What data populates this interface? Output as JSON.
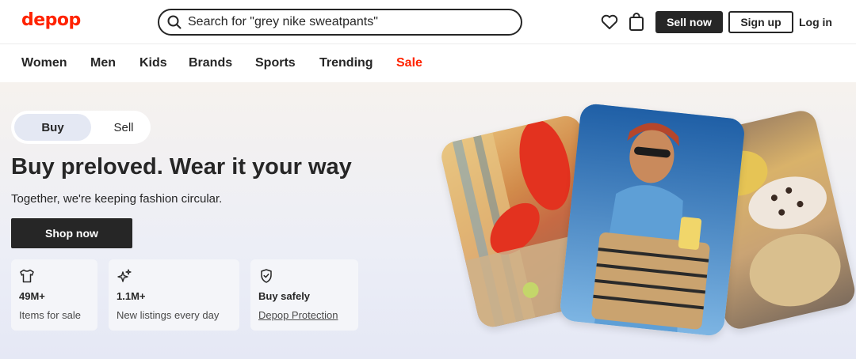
{
  "header": {
    "logo": "depop",
    "search_placeholder": "Search for \"grey nike sweatpants\"",
    "sell_now": "Sell now",
    "sign_up": "Sign up",
    "log_in": "Log in"
  },
  "nav": {
    "items": [
      "Women",
      "Men",
      "Kids",
      "Brands",
      "Sports",
      "Trending",
      "Sale"
    ]
  },
  "hero": {
    "toggle": {
      "buy": "Buy",
      "sell": "Sell"
    },
    "headline": "Buy preloved. Wear it your way",
    "subtitle": "Together, we're keeping fashion circular.",
    "cta": "Shop now",
    "stats": [
      {
        "icon": "tshirt-icon",
        "value": "49M+",
        "label": "Items for sale"
      },
      {
        "icon": "sparkle-icon",
        "value": "1.1M+",
        "label": "New listings every day"
      },
      {
        "icon": "shield-icon",
        "value": "Buy safely",
        "label": "Depop Protection"
      }
    ]
  },
  "colors": {
    "brand": "#ff2300",
    "dark": "#262626",
    "sale": "#ff2300"
  }
}
